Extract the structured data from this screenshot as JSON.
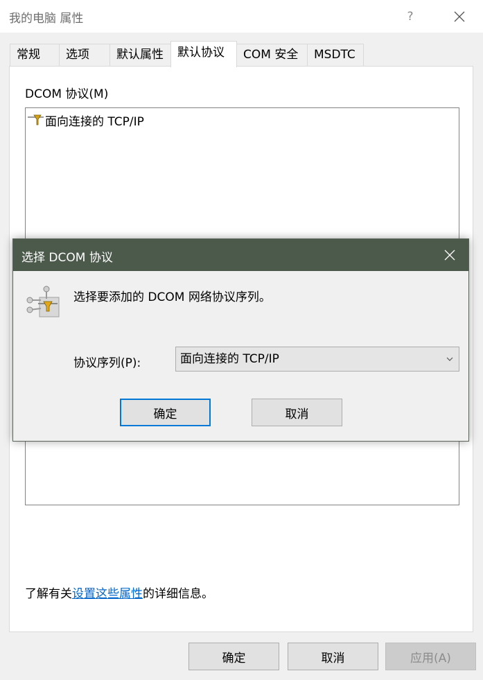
{
  "window": {
    "title": "我的电脑 属性",
    "help_label": "?",
    "tabs": [
      {
        "label": "常规",
        "active": false
      },
      {
        "label": "选项",
        "active": false
      },
      {
        "label": "默认属性",
        "active": false
      },
      {
        "label": "默认协议",
        "active": true
      },
      {
        "label": "COM 安全",
        "active": false
      },
      {
        "label": "MSDTC",
        "active": false
      }
    ],
    "panel": {
      "group_label": "DCOM 协议(M)",
      "protocols": [
        {
          "label": "面向连接的 TCP/IP",
          "icon": "network-protocol-icon"
        }
      ],
      "info": {
        "prefix": "了解有关",
        "link": "设置这些属性",
        "suffix": "的详细信息。"
      }
    },
    "buttons": {
      "ok": "确定",
      "cancel": "取消",
      "apply": "应用(A)"
    }
  },
  "dialog": {
    "title": "选择 DCOM 协议",
    "description": "选择要添加的 DCOM 网络协议序列。",
    "protocol_label": "协议序列(P):",
    "protocol_value": "面向连接的 TCP/IP",
    "ok": "确定",
    "cancel": "取消"
  },
  "colors": {
    "dialog_titlebar": "#4c5a4c",
    "link": "#0066cc",
    "focus_border": "#0078d7"
  }
}
